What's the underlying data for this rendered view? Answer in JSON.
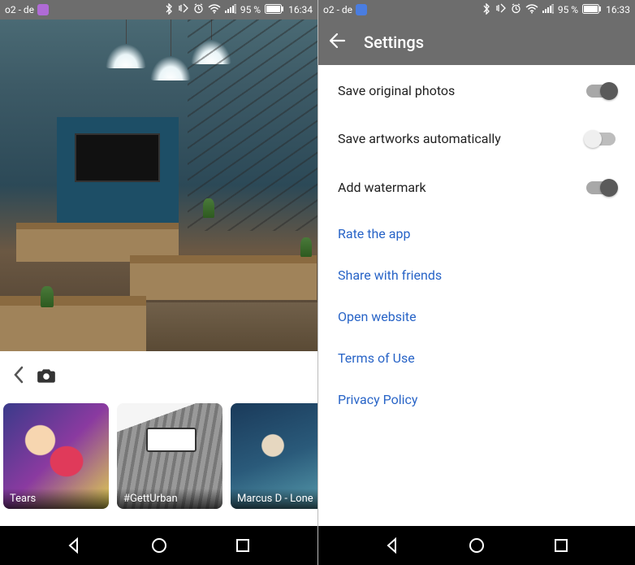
{
  "left": {
    "status": {
      "carrier": "o2 - de",
      "battery": "95 %",
      "time": "16:34"
    },
    "filters": [
      {
        "label": "Tears"
      },
      {
        "label": "#GettUrban",
        "brand": "Gett"
      },
      {
        "label": "Marcus D - Lone"
      }
    ]
  },
  "right": {
    "status": {
      "carrier": "o2 - de",
      "battery": "95 %",
      "time": "16:33"
    },
    "appbar": {
      "title": "Settings"
    },
    "items": [
      {
        "label": "Save original photos",
        "type": "toggle",
        "on": true
      },
      {
        "label": "Save artworks automatically",
        "type": "toggle",
        "on": false
      },
      {
        "label": "Add watermark",
        "type": "toggle",
        "on": true
      },
      {
        "label": "Rate the app",
        "type": "link"
      },
      {
        "label": "Share with friends",
        "type": "link"
      },
      {
        "label": "Open website",
        "type": "link"
      },
      {
        "label": "Terms of Use",
        "type": "link"
      },
      {
        "label": "Privacy Policy",
        "type": "link"
      }
    ]
  }
}
